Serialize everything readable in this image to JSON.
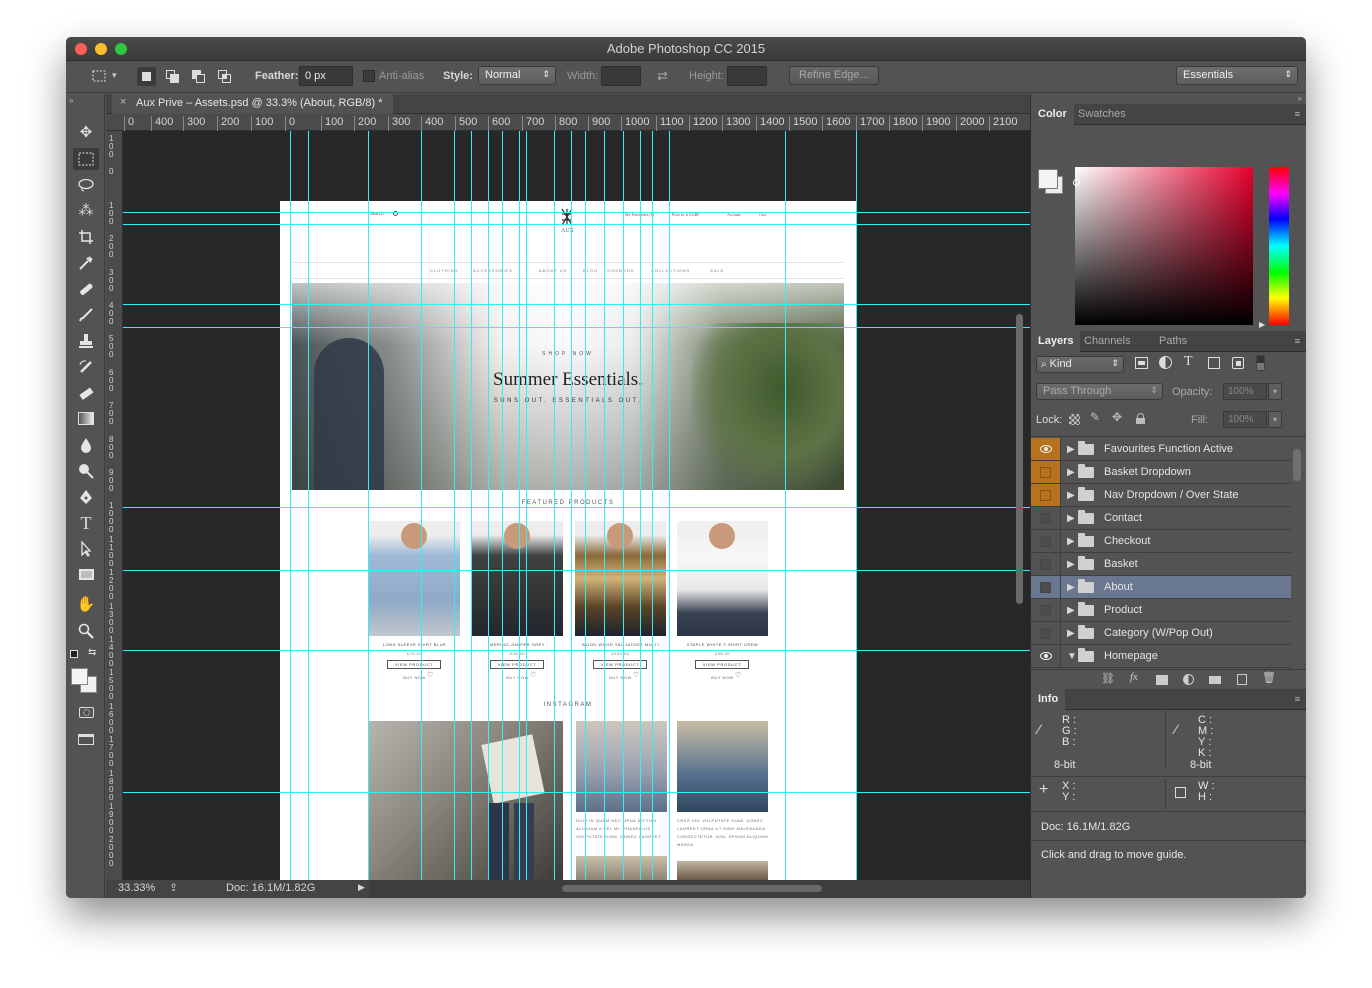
{
  "app": {
    "title": "Adobe Photoshop CC 2015"
  },
  "options_bar": {
    "feather_label": "Feather:",
    "feather_value": "0 px",
    "antialias_label": "Anti-alias",
    "style_label": "Style:",
    "style_value": "Normal",
    "width_label": "Width:",
    "height_label": "Height:",
    "refine_edge": "Refine Edge...",
    "workspace": "Essentials"
  },
  "document": {
    "tab_title": "Aux Prive – Assets.psd @ 33.3% (About, RGB/8) *",
    "ruler_h": [
      "0",
      "400",
      "300",
      "200",
      "100",
      "0",
      "100",
      "200",
      "300",
      "400",
      "500",
      "600",
      "700",
      "800",
      "900",
      "1000",
      "1100",
      "1200",
      "1300",
      "1400",
      "1500",
      "1600",
      "1700",
      "1800",
      "1900",
      "2000",
      "2100"
    ],
    "ruler_v": [
      "100",
      "0",
      "100",
      "200",
      "300",
      "400",
      "500",
      "600",
      "700",
      "800",
      "900",
      "1000",
      "1100",
      "1200",
      "1300",
      "1400",
      "1500",
      "1600",
      "1700",
      "1800",
      "1900",
      "2000"
    ]
  },
  "status_bar": {
    "zoom": "33.33%",
    "doc_size": "Doc: 16.1M/1.82G"
  },
  "webpage": {
    "search": "Search",
    "top_right": [
      "My Favourites (1)",
      "Price in ∨ EGBP",
      "Account",
      "Cart"
    ],
    "logo": "AUX",
    "nav": [
      "CLOTHING",
      "ACCESSORIES",
      "ABOUT US",
      "BLOG",
      "LOOKBOOK",
      "COLLECTIONS",
      "SALE"
    ],
    "hero_kicker": "SHOP NOW",
    "hero_title": "Summer Essentials.",
    "hero_subtitle": "SUNS OUT. ESSENTIALS OUT.",
    "featured_heading": "FEATURED PRODUCTS",
    "products": [
      {
        "name": "LONG SLEEVE SHIRT BLUE",
        "price": "£79.00",
        "button": "VIEW PRODUCT",
        "buy": "BUY NOW"
      },
      {
        "name": "MERINO JUMPER GREY",
        "price": "£49.00",
        "button": "VIEW PRODUCT",
        "buy": "BUY NOW"
      },
      {
        "name": "WOOD WOOD YAL JACKET MULTI",
        "price": "£250.00",
        "button": "VIEW PRODUCT",
        "buy": "BUY NOW"
      },
      {
        "name": "STAPLE WHITE T-SHIRT CREW",
        "price": "£55.00",
        "button": "VIEW PRODUCT",
        "buy": "BUY NOW"
      }
    ],
    "instagram_heading": "INSTAGRAM",
    "insta_captions": [
      "DUIS IN QUAM NEC URNA DICTUM ALIQUAM A VEL MI. PHASELLUS VULPUTATE DIAM. DONEC LAOREET",
      "CRAS VEL VULPUTATE DIAM. DONEC LAOREET URNA UT NIBH MALESUADA CONSECTETUR. NISL SPSUM ALIQUAM MASSA"
    ]
  },
  "color_panel": {
    "tabs": [
      "Color",
      "Swatches"
    ]
  },
  "layers_panel": {
    "tabs": [
      "Layers",
      "Channels",
      "Paths"
    ],
    "kind": "Kind",
    "blend_mode": "Pass Through",
    "opacity_label": "Opacity:",
    "opacity_value": "100%",
    "lock_label": "Lock:",
    "fill_label": "Fill:",
    "fill_value": "100%",
    "layers": [
      {
        "name": "Favourites Function Active",
        "visible": true,
        "color": "#b5731f"
      },
      {
        "name": "Basket Dropdown",
        "visible": false,
        "color": "#b5731f"
      },
      {
        "name": "Nav Dropdown / Over State",
        "visible": false,
        "color": "#b5731f"
      },
      {
        "name": "Contact",
        "visible": false
      },
      {
        "name": "Checkout",
        "visible": false
      },
      {
        "name": "Basket",
        "visible": false
      },
      {
        "name": "About",
        "visible": false,
        "selected": true
      },
      {
        "name": "Product",
        "visible": false
      },
      {
        "name": "Category (W/Pop Out)",
        "visible": false
      },
      {
        "name": "Homepage",
        "visible": true,
        "expanded": true
      }
    ]
  },
  "info_panel": {
    "tab": "Info",
    "rgb": [
      "R :",
      "G :",
      "B :"
    ],
    "cmyk": [
      "C :",
      "M :",
      "Y :",
      "K :"
    ],
    "bit_depth_1": "8-bit",
    "bit_depth_2": "8-bit",
    "xy": [
      "X :",
      "Y :"
    ],
    "wh": [
      "W :",
      "H :"
    ],
    "doc": "Doc: 16.1M/1.82G",
    "hint": "Click and drag to move guide."
  },
  "colors": {
    "accent_guide": "#2ef0f6",
    "selected_layer": "#6a7790",
    "layer_color_label": "#b5731f"
  }
}
